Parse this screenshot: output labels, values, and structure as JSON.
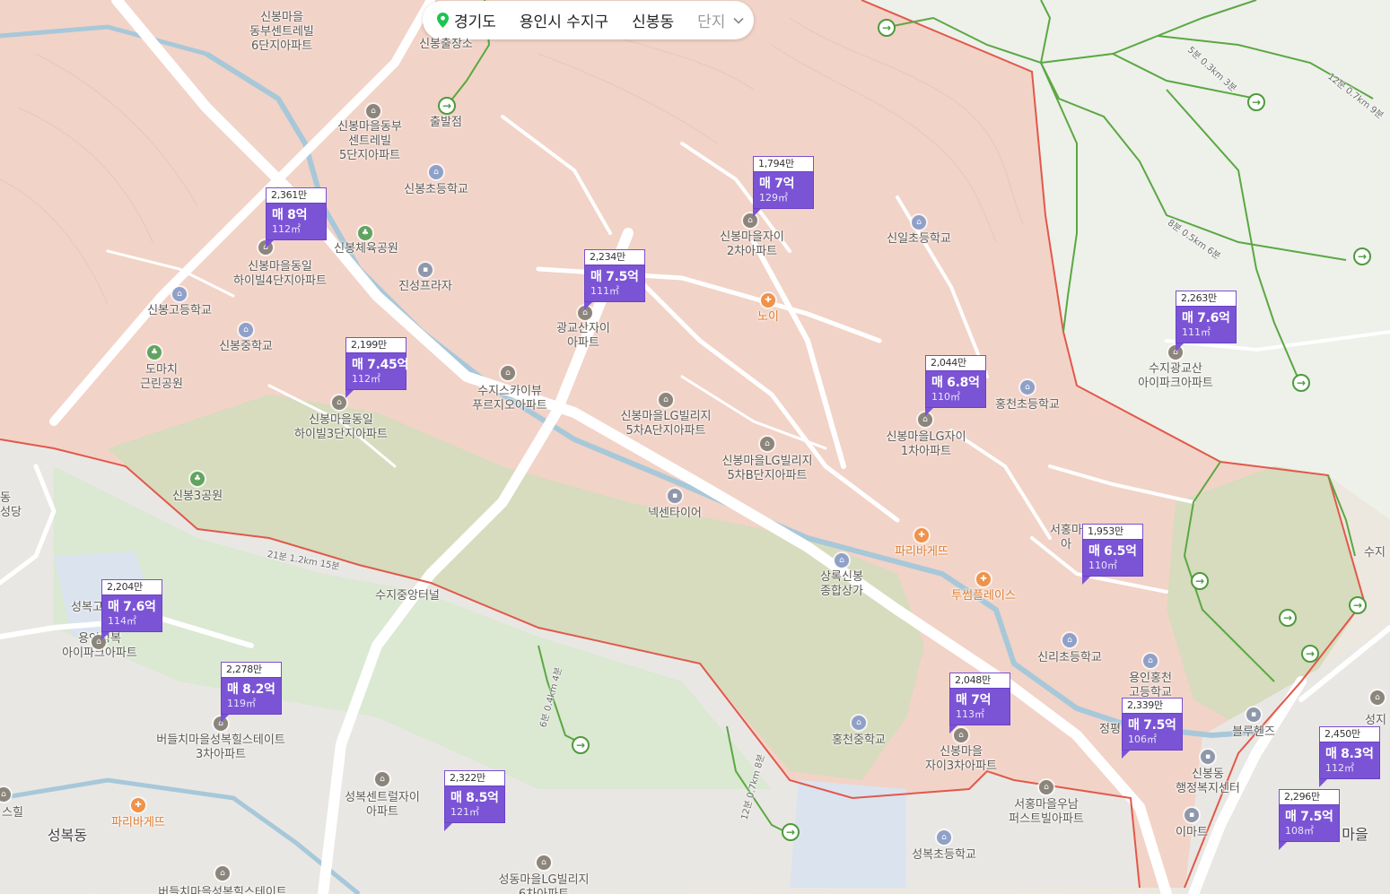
{
  "breadcrumb": {
    "province": "경기도",
    "city": "용인시 수지구",
    "dong": "신봉동",
    "level": "단지"
  },
  "price_markers": [
    {
      "price": "2,361만",
      "deal": "매 8억",
      "area": "112㎡"
    },
    {
      "price": "1,794만",
      "deal": "매 7억",
      "area": "129㎡"
    },
    {
      "price": "2,234만",
      "deal": "매 7.5억",
      "area": "111㎡"
    },
    {
      "price": "2,199만",
      "deal": "매 7.45억",
      "area": "112㎡"
    },
    {
      "price": "2,263만",
      "deal": "매 7.6억",
      "area": "111㎡"
    },
    {
      "price": "2,044만",
      "deal": "매 6.8억",
      "area": "110㎡"
    },
    {
      "price": "1,953만",
      "deal": "매 6.5억",
      "area": "110㎡"
    },
    {
      "price": "2,204만",
      "deal": "매 7.6억",
      "area": "114㎡"
    },
    {
      "price": "2,278만",
      "deal": "매 8.2억",
      "area": "119㎡"
    },
    {
      "price": "2,048만",
      "deal": "매 7억",
      "area": "113㎡"
    },
    {
      "price": "2,339만",
      "deal": "매 7.5억",
      "area": "106㎡"
    },
    {
      "price": "2,450만",
      "deal": "매 8.3억",
      "area": "112㎡"
    },
    {
      "price": "2,296만",
      "deal": "매 7.5억",
      "area": "108㎡"
    },
    {
      "price": "2,322만",
      "deal": "매 8.5억",
      "area": "121㎡"
    }
  ],
  "labels": [
    {
      "text": "신봉마을\n동부센트레빌\n6단지아파트"
    },
    {
      "text": "신봉마을동부\n센트레빌\n5단지아파트"
    },
    {
      "text": "신봉초등학교"
    },
    {
      "text": "신봉체육공원"
    },
    {
      "text": "신봉마을동일\n하이빌4단지아파트"
    },
    {
      "text": "신봉고등학교"
    },
    {
      "text": "진성프라자"
    },
    {
      "text": "신봉중학교"
    },
    {
      "text": "도마치\n근린공원"
    },
    {
      "text": "신봉마을동일\n하이빌3단지아파트"
    },
    {
      "text": "수지스카이뷰\n푸르지오아파트"
    },
    {
      "text": "광교산자이\n아파트"
    },
    {
      "text": "신봉마을자이\n2차아파트"
    },
    {
      "text": "신일초등학교"
    },
    {
      "text": "노이"
    },
    {
      "text": "신봉마을LG빌리지\n5차A단지아파트"
    },
    {
      "text": "신봉마을LG빌리지\n5차B단지아파트"
    },
    {
      "text": "신봉마을LG자이\n1차아파트"
    },
    {
      "text": "홍천초등학교"
    },
    {
      "text": "수지광교산\n아이파크아파트"
    },
    {
      "text": "신봉3공원"
    },
    {
      "text": "넥센타이어"
    },
    {
      "text": "파리바게뜨"
    },
    {
      "text": "상록신봉\n종합상가"
    },
    {
      "text": "투썸플레이스"
    },
    {
      "text": "서홍마\n아"
    },
    {
      "text": "수지중앙터널"
    },
    {
      "text": "성복고"
    },
    {
      "text": "용인성복\n아이파크아파트"
    },
    {
      "text": "버들치마을성복힐스테이트\n3차아파트"
    },
    {
      "text": "신리초등학교"
    },
    {
      "text": "용인홍천\n고등학교"
    },
    {
      "text": "홍천중학교"
    },
    {
      "text": "신봉마을\n자이3차아파트"
    },
    {
      "text": "정평"
    },
    {
      "text": "블루헨즈"
    },
    {
      "text": "신봉동\n행정복지센터"
    },
    {
      "text": "서홍마을우남\n퍼스트빌아파트"
    },
    {
      "text": "이마트"
    },
    {
      "text": "성복센트럴자이\n아파트"
    },
    {
      "text": "성복초등학교"
    },
    {
      "text": "성동마을LG빌리지\n6차아파트"
    },
    {
      "text": "파리바게뜨"
    },
    {
      "text": "성복동"
    },
    {
      "text": "스힐"
    },
    {
      "text": "버들치마을성복힐스테이트"
    },
    {
      "text": "출발점"
    },
    {
      "text": "신봉출장소"
    },
    {
      "text": "마을"
    },
    {
      "text": "성지"
    },
    {
      "text": "수지"
    },
    {
      "text": "동\n사성당"
    }
  ],
  "trail_labels": [
    {
      "text": "5분 0.3km 3분"
    },
    {
      "text": "12분 0.7km 9분"
    },
    {
      "text": "8분 0.5km 6분"
    },
    {
      "text": "21분 1.2km 15분"
    },
    {
      "text": "6분 0.4km 4분"
    },
    {
      "text": "12분 0.7km 8분"
    }
  ],
  "colors": {
    "base": "#ece7df",
    "district": "#f1ccc0",
    "green": "#cfd8b8",
    "water": "#a7c8d9",
    "road": "#ffffff",
    "boundary": "#e2584a",
    "trail": "#5aa842",
    "marker": "#7b54d6"
  }
}
